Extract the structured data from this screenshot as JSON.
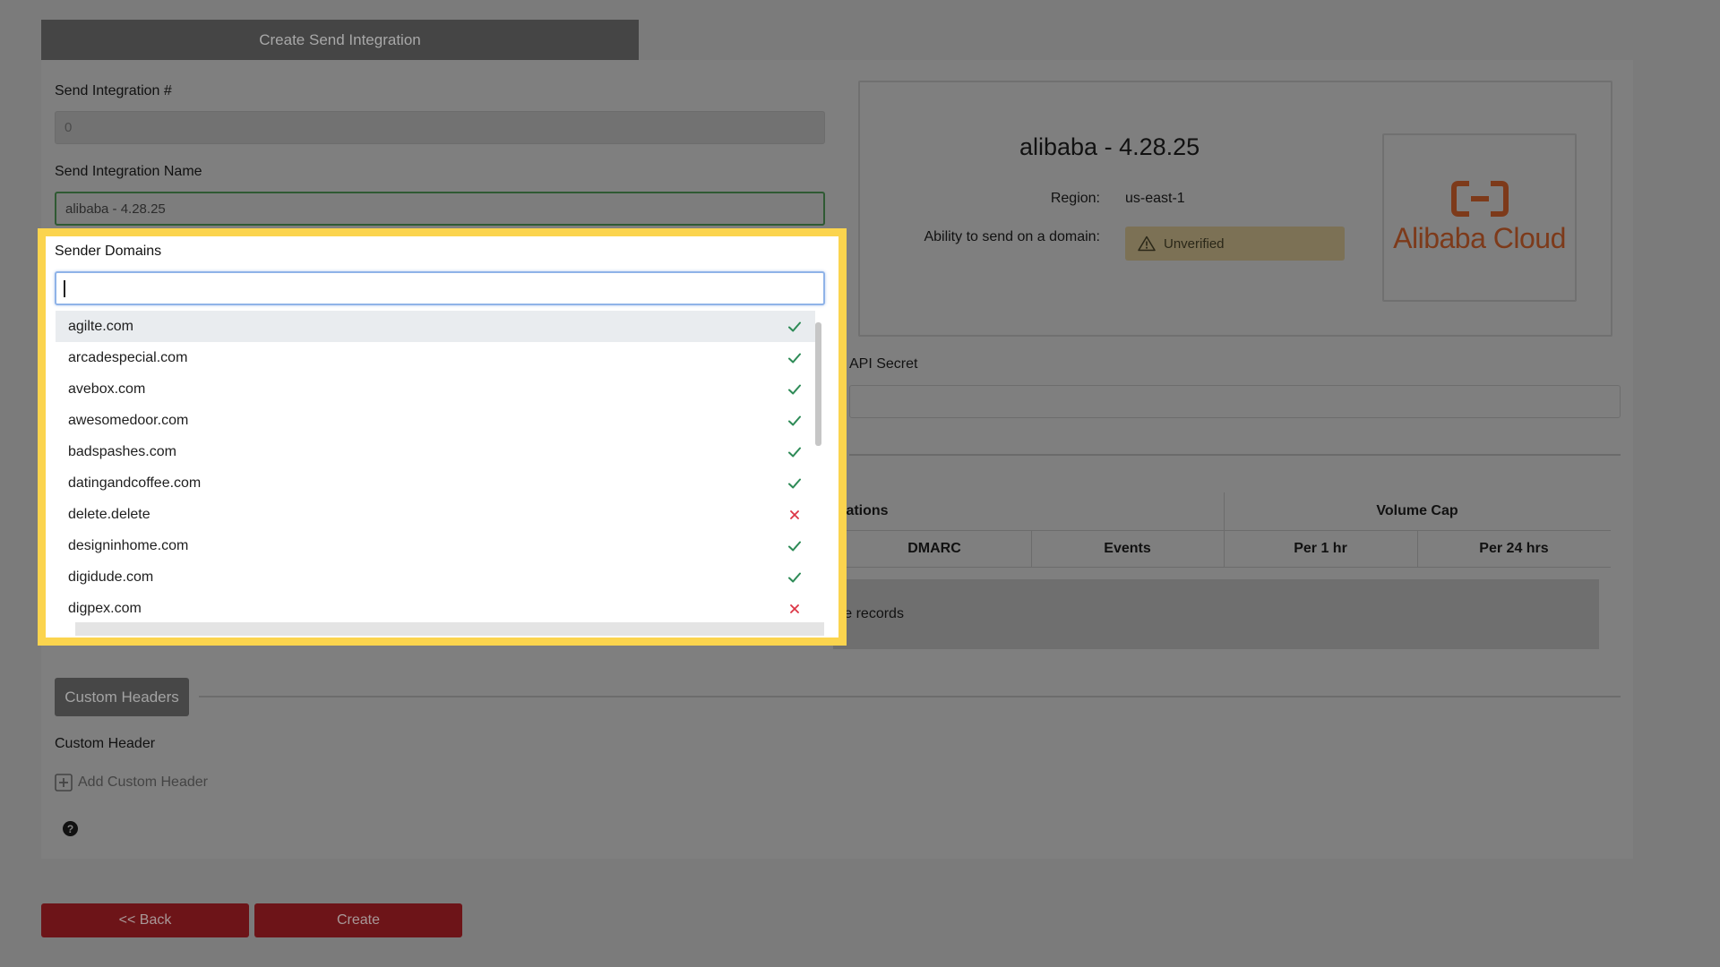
{
  "tab": {
    "label": "Create Send Integration"
  },
  "form": {
    "id_label": "Send Integration #",
    "id_value": "0",
    "name_label": "Send Integration Name",
    "name_value": "alibaba - 4.28.25",
    "sender_domains_label": "Sender Domains",
    "api_secret_label": "API Secret"
  },
  "provider": {
    "title": "alibaba - 4.28.25",
    "region_label": "Region:",
    "region_value": "us-east-1",
    "ability_label": "Ability to send on a domain:",
    "status": "Unverified",
    "logo_text": "Alibaba Cloud",
    "logo_color": "#ff6a00"
  },
  "table": {
    "group_partial": "nt cations",
    "volume_cap": "Volume Cap",
    "columns": [
      "DMARC",
      "Events",
      "Per 1 hr",
      "Per 24 hrs"
    ],
    "empty_partial": "ab e records"
  },
  "custom_headers": {
    "section_label": "Custom Headers",
    "field_label": "Custom Header",
    "add_label": "Add Custom Header",
    "help_symbol": "?"
  },
  "buttons": {
    "back": "<< Back",
    "create": "Create"
  },
  "dropdown": {
    "items": [
      {
        "label": "agilte.com",
        "verified": true
      },
      {
        "label": "arcadespecial.com",
        "verified": true
      },
      {
        "label": "avebox.com",
        "verified": true
      },
      {
        "label": "awesomedoor.com",
        "verified": true
      },
      {
        "label": "badspashes.com",
        "verified": true
      },
      {
        "label": "datingandcoffee.com",
        "verified": true
      },
      {
        "label": "delete.delete",
        "verified": false
      },
      {
        "label": "designinhome.com",
        "verified": true
      },
      {
        "label": "digidude.com",
        "verified": true
      },
      {
        "label": "digpex.com",
        "verified": false
      }
    ],
    "check_color": "#2e8b57",
    "cross_color": "#dc3545",
    "highlight_color": "#fbd44e"
  }
}
